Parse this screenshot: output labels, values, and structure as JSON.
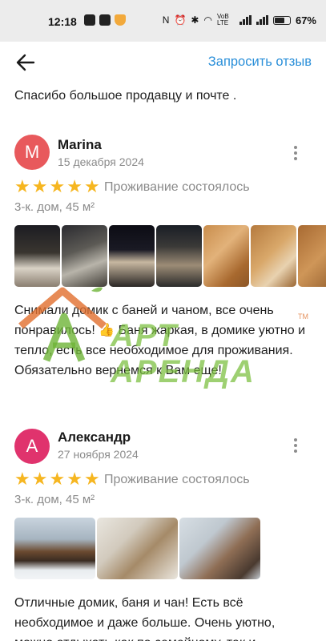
{
  "status_bar": {
    "time": "12:18",
    "network_label": "VoB LTE",
    "battery_percent": "67%"
  },
  "header": {
    "request_review_label": "Запросить отзыв"
  },
  "previous_review_tail": "Спасибо большое продавцу и почте .",
  "reviews": [
    {
      "avatar_letter": "M",
      "author": "Marina",
      "date": "15 декабря 2024",
      "rating": 5,
      "stay_status": "Проживание состоялось",
      "property": "3-к. дом, 45 м²",
      "text": "Снимали домик с баней и чаном, все очень понравилось! 👍 Баня жаркая, в домике уютно и тепло, есть все необходимое для проживания. Обязательно вернемся к Вам еще!"
    },
    {
      "avatar_letter": "А",
      "author": "Александр",
      "date": "27 ноября 2024",
      "rating": 5,
      "stay_status": "Проживание состоялось",
      "property": "3-к. дом, 45 м²",
      "text": "Отличные домик, баня и чан! Есть всё необходимое и даже больше. Очень уютно, можно отдыхать как по семейному, так и"
    }
  ],
  "watermark": {
    "text": "АРТ АРЕНДА",
    "tm": "TM"
  },
  "colors": {
    "accent_link": "#2a8fd9",
    "star": "#f6b620",
    "avatar_marina": "#e8595c",
    "avatar_alexander": "#e0336d",
    "secondary_text": "#8b8b8b"
  }
}
